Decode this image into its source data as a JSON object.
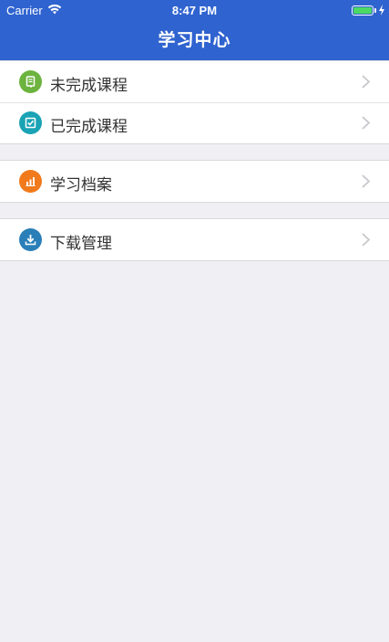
{
  "status_bar": {
    "carrier": "Carrier",
    "time": "8:47 PM"
  },
  "nav": {
    "title": "学习中心"
  },
  "groups": [
    {
      "items": [
        {
          "label": "未完成课程",
          "icon": "book-icon",
          "color": "#6db33f"
        },
        {
          "label": "已完成课程",
          "icon": "check-icon",
          "color": "#1aa3b5"
        }
      ]
    },
    {
      "items": [
        {
          "label": "学习档案",
          "icon": "chart-icon",
          "color": "#f07a1c"
        }
      ]
    },
    {
      "items": [
        {
          "label": "下载管理",
          "icon": "download-icon",
          "color": "#2a7fb8"
        }
      ]
    }
  ],
  "colors": {
    "header": "#2f63cf",
    "background": "#efeff4"
  }
}
